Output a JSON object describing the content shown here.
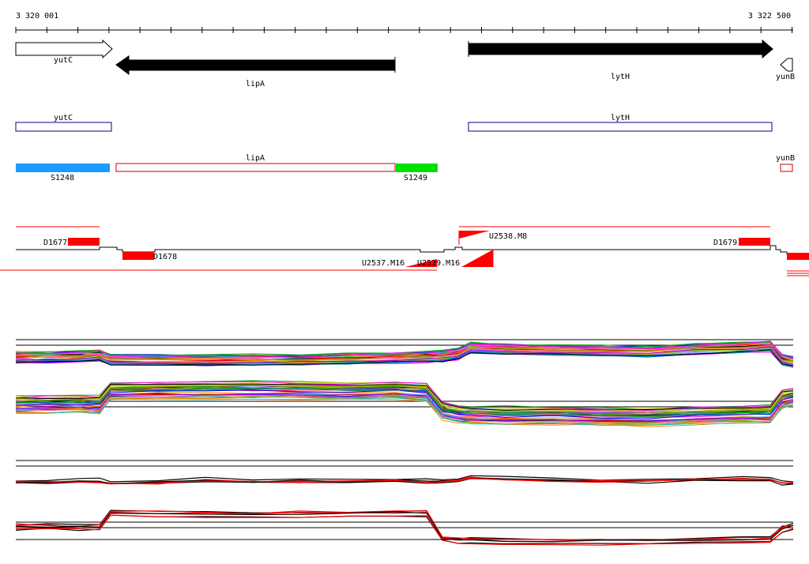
{
  "ruler": {
    "start_label": "3 320 001",
    "end_label": "3 322 500"
  },
  "genes_top": [
    {
      "name": "yutC",
      "strand": "+",
      "fill": "#ffffff"
    },
    {
      "name": "lipA",
      "strand": "-",
      "fill": "#000000"
    },
    {
      "name": "lytH",
      "strand": "+",
      "fill": "#000000"
    },
    {
      "name": "yunB",
      "strand": "-",
      "fill": "#ffffff"
    }
  ],
  "genes_plus_track": [
    {
      "name": "yutC",
      "color": "#00008b"
    },
    {
      "name": "lytH",
      "color": "#00008b"
    }
  ],
  "genes_minus_track": [
    {
      "name": "lipA",
      "color": "#cc0000"
    },
    {
      "name": "yunB",
      "color": "#cc0000"
    }
  ],
  "segments": [
    {
      "name": "S1248",
      "color": "#1e9bff"
    },
    {
      "name": "S1249",
      "color": "#00e000"
    }
  ],
  "transcripts": [
    {
      "name": "D1677"
    },
    {
      "name": "D1678"
    },
    {
      "name": "U2537.M16"
    },
    {
      "name": "U2539.M16"
    },
    {
      "name": "U2538.M8"
    },
    {
      "name": "D1679"
    }
  ],
  "colors": {
    "plus": "#00008b",
    "minus": "#cc0000",
    "transcript": "#ff0000"
  }
}
